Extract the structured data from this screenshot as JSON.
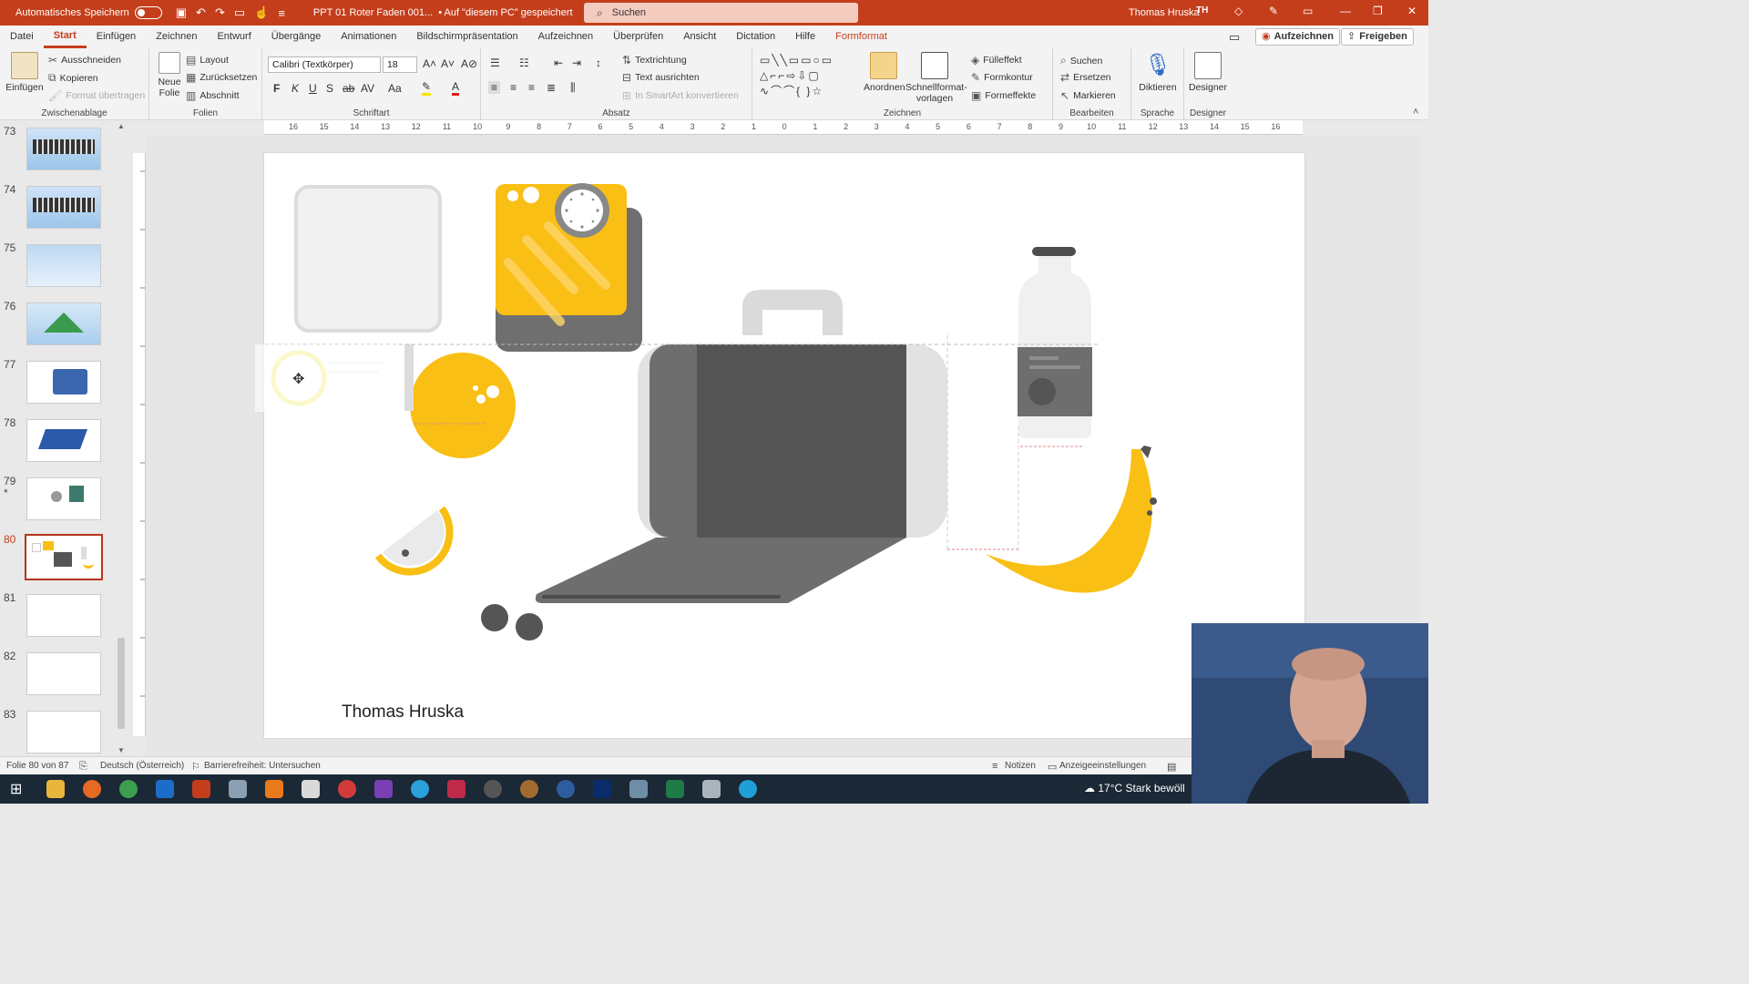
{
  "titlebar": {
    "autosave_label": "Automatisches Speichern",
    "doc_title": "PPT 01 Roter Faden 001...",
    "save_state": "• Auf \"diesem PC\" gespeichert",
    "search_placeholder": "Suchen",
    "user_name": "Thomas Hruska",
    "user_initials": "TH"
  },
  "tabs": [
    "Datei",
    "Start",
    "Einfügen",
    "Zeichnen",
    "Entwurf",
    "Übergänge",
    "Animationen",
    "Bildschirmpräsentation",
    "Aufzeichnen",
    "Überprüfen",
    "Ansicht",
    "Dictation",
    "Hilfe",
    "Formformat"
  ],
  "menu_right": {
    "record_label": "Aufzeichnen",
    "share_label": "Freigeben"
  },
  "ribbon": {
    "clipboard": {
      "label": "Zwischenablage",
      "paste": "Einfügen",
      "cut": "Ausschneiden",
      "copy": "Kopieren",
      "format_painter": "Format übertragen"
    },
    "slides": {
      "label": "Folien",
      "new_slide": "Neue Folie",
      "layout": "Layout",
      "reset": "Zurücksetzen",
      "section": "Abschnitt"
    },
    "font": {
      "label": "Schriftart",
      "font_name": "Calibri (Textkörper)",
      "font_size": "18",
      "bold": "F",
      "italic": "K",
      "underline": "U",
      "shadow": "S",
      "strike": "ab",
      "spacing": "AV",
      "case": "Aa"
    },
    "paragraph": {
      "label": "Absatz",
      "text_direction": "Textrichtung",
      "align_text": "Text ausrichten",
      "smartart": "In SmartArt konvertieren"
    },
    "drawing": {
      "label": "Zeichnen",
      "arrange": "Anordnen",
      "quick_styles": "Schnellformat-vorlagen",
      "fill": "Fülleffekt",
      "outline": "Formkontur",
      "effects": "Formeffekte"
    },
    "editing": {
      "label": "Bearbeiten",
      "find": "Suchen",
      "replace": "Ersetzen",
      "select": "Markieren"
    },
    "voice": {
      "label": "Sprache",
      "dictate": "Diktieren"
    },
    "designer": {
      "label": "Designer",
      "designer": "Designer"
    }
  },
  "slides_panel": {
    "numbers": [
      "73",
      "74",
      "75",
      "76",
      "77",
      "78",
      "79",
      "80",
      "81",
      "82",
      "83"
    ],
    "current": "80",
    "star_marker": "*"
  },
  "ruler_ticks": [
    "16",
    "15",
    "14",
    "13",
    "12",
    "11",
    "10",
    "9",
    "8",
    "7",
    "6",
    "5",
    "4",
    "3",
    "2",
    "1",
    "0",
    "1",
    "2",
    "3",
    "4",
    "5",
    "6",
    "7",
    "8",
    "9",
    "10",
    "11",
    "12",
    "13",
    "14",
    "15",
    "16"
  ],
  "slide": {
    "author": "Thomas Hruska"
  },
  "statusbar": {
    "slide_info": "Folie 80 von 87",
    "language": "Deutsch (Österreich)",
    "accessibility": "Barrierefreiheit: Untersuchen",
    "notes": "Notizen",
    "display_settings": "Anzeigeeinstellungen"
  },
  "taskbar": {
    "weather": "17°C  Stark bewöll"
  },
  "colors": {
    "accent": "#c43e1c",
    "yellow": "#f9bf14",
    "gray": "#6e6e6e",
    "light_gray": "#e4e4e4"
  }
}
